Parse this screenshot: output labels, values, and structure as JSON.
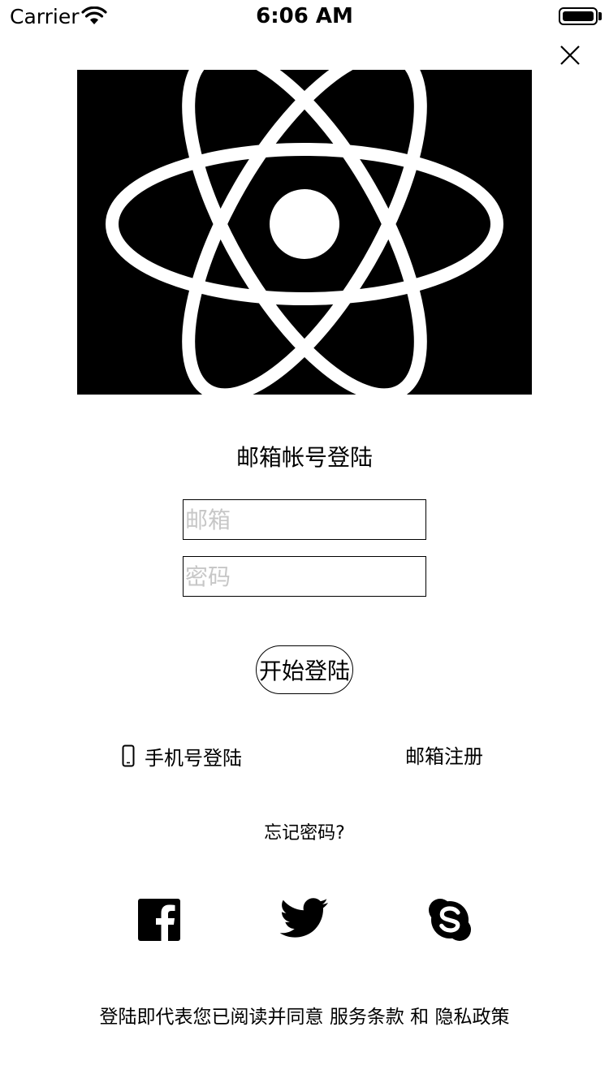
{
  "status_bar": {
    "carrier": "Carrier",
    "time": "6:06 AM"
  },
  "login": {
    "title": "邮箱帐号登陆",
    "email_placeholder": "邮箱",
    "password_placeholder": "密码",
    "submit_label": "开始登陆"
  },
  "links": {
    "phone_login": "手机号登陆",
    "email_register": "邮箱注册",
    "forgot_password": "忘记密码?"
  },
  "social": [
    "facebook-icon",
    "twitter-icon",
    "skype-icon"
  ],
  "terms": {
    "prefix": "登陆即代表您已阅读并同意 ",
    "service": "服务条款",
    "and": " 和 ",
    "privacy": "隐私政策"
  }
}
